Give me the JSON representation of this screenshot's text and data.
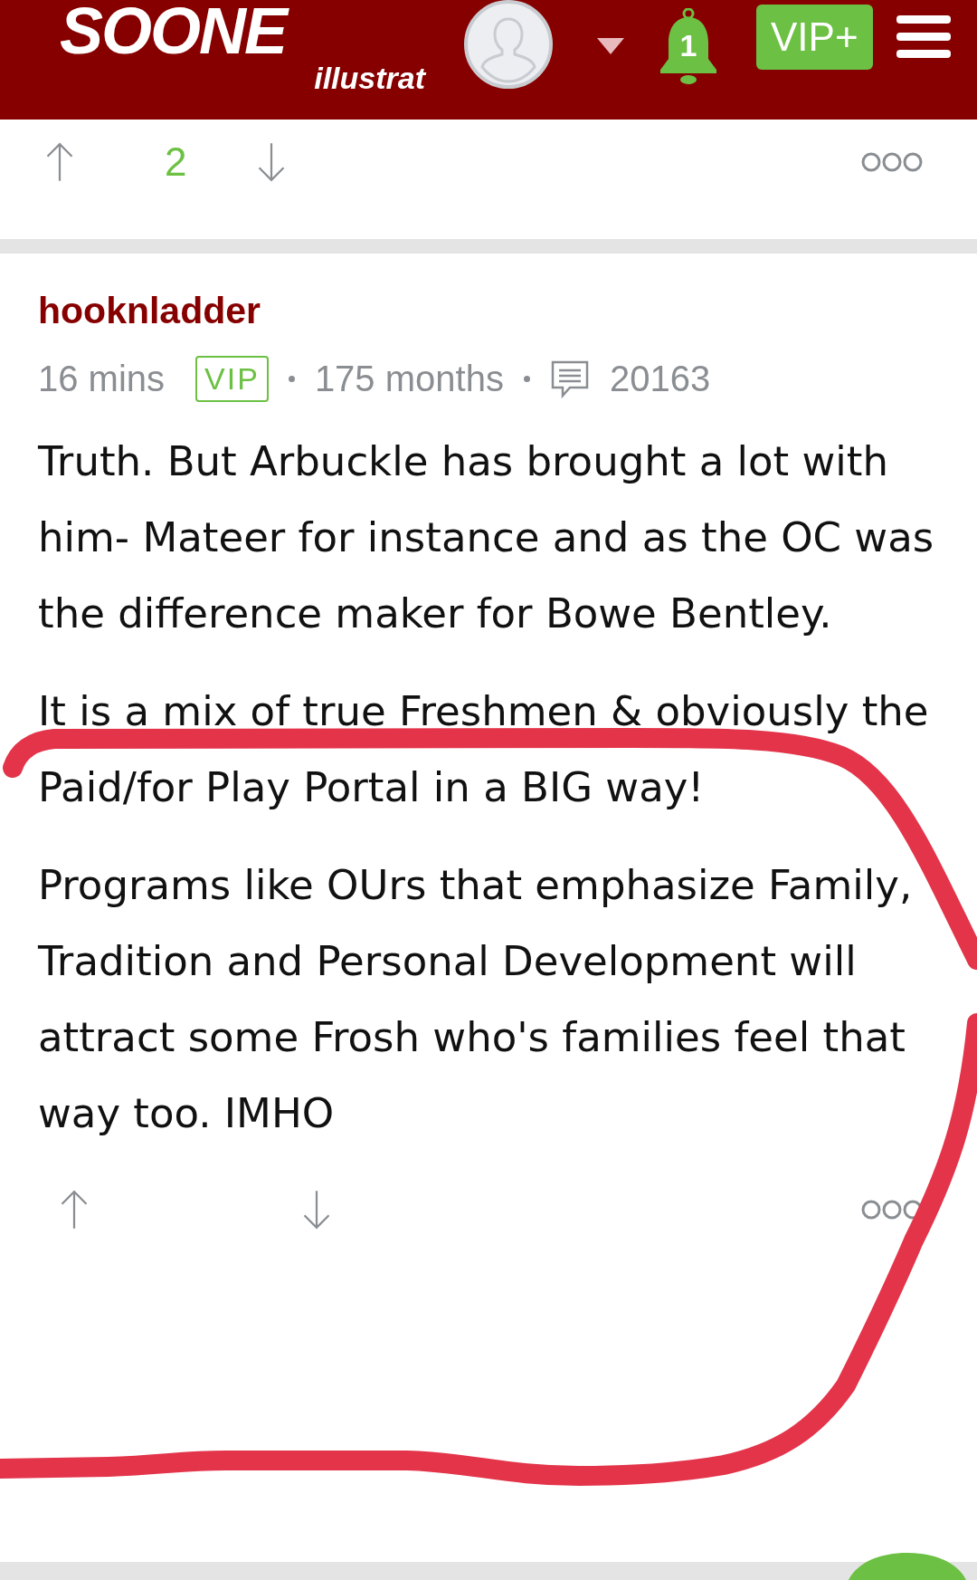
{
  "header": {
    "logo_title": "SOONE",
    "logo_subtitle": "illustrat",
    "notification_count": "1",
    "vip_button": "VIP+"
  },
  "previous_post": {
    "vote_count": "2"
  },
  "post": {
    "username": "hooknladder",
    "time": "16 mins",
    "badge": "VIP",
    "tenure": "175 months",
    "post_count": "20163",
    "paragraphs": [
      "Truth. But Arbuckle has brought a lot with him- Mateer for instance and as the OC was the difference maker for Bowe Bentley.",
      "It is a mix of true Freshmen & obviously the Paid/for Play Portal in a BIG way!",
      "Programs like OUrs that emphasize Family, Tradition and Personal Development will attract some Frosh who's families feel that way too. IMHO"
    ]
  }
}
